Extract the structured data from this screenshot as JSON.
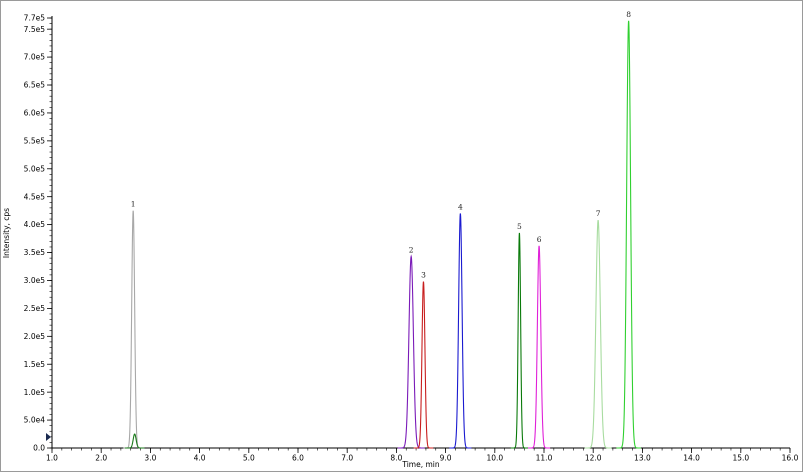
{
  "chart_data": {
    "type": "line",
    "title": "",
    "xlabel": "Time, min",
    "ylabel": "Intensity, cps",
    "xlim": [
      1.0,
      16.0
    ],
    "ylim": [
      0,
      770000
    ],
    "xticks": [
      1.0,
      2.0,
      3.0,
      4.0,
      5.0,
      6.0,
      7.0,
      8.0,
      9.0,
      10.0,
      11.0,
      12.0,
      13.0,
      14.0,
      15.0,
      16.0
    ],
    "xtick_labels": [
      "1.0",
      "2.0",
      "3.0",
      "4.0",
      "5.0",
      "6.0",
      "7.0",
      "8.0",
      "9.0",
      "10.0",
      "11.0",
      "12.0",
      "13.0",
      "14.0",
      "15.0",
      "16.0"
    ],
    "yticks": [
      0,
      50000,
      100000,
      150000,
      200000,
      250000,
      300000,
      350000,
      400000,
      450000,
      500000,
      550000,
      600000,
      650000,
      700000,
      750000,
      770000
    ],
    "ytick_labels": [
      "0.0",
      "5.0e4",
      "1.0e5",
      "1.5e5",
      "2.0e5",
      "2.5e5",
      "3.0e5",
      "3.5e5",
      "4.0e5",
      "4.5e5",
      "5.0e5",
      "5.5e5",
      "6.0e5",
      "6.5e5",
      "7.0e5",
      "7.5e5",
      "7.7e5"
    ],
    "grid": false,
    "series": [
      {
        "label": "1",
        "rt": 2.65,
        "height": 425000,
        "width": 0.03,
        "color": "#a8a8a8"
      },
      {
        "label": "",
        "rt": 2.68,
        "height": 25000,
        "width": 0.03,
        "color": "#1a7a1a"
      },
      {
        "label": "2",
        "rt": 8.3,
        "height": 343000,
        "width": 0.045,
        "color": "#7a1ab8"
      },
      {
        "label": "3",
        "rt": 8.55,
        "height": 298000,
        "width": 0.03,
        "color": "#c81e1e"
      },
      {
        "label": "4",
        "rt": 9.3,
        "height": 420000,
        "width": 0.035,
        "color": "#1a1ad0"
      },
      {
        "label": "5",
        "rt": 10.5,
        "height": 385000,
        "width": 0.025,
        "color": "#0a7a0a"
      },
      {
        "label": "6",
        "rt": 10.9,
        "height": 362000,
        "width": 0.035,
        "color": "#e020d8"
      },
      {
        "label": "7",
        "rt": 12.1,
        "height": 408000,
        "width": 0.045,
        "color": "#a8dca0"
      },
      {
        "label": "8",
        "rt": 12.72,
        "height": 765000,
        "width": 0.04,
        "color": "#30d030"
      }
    ]
  }
}
